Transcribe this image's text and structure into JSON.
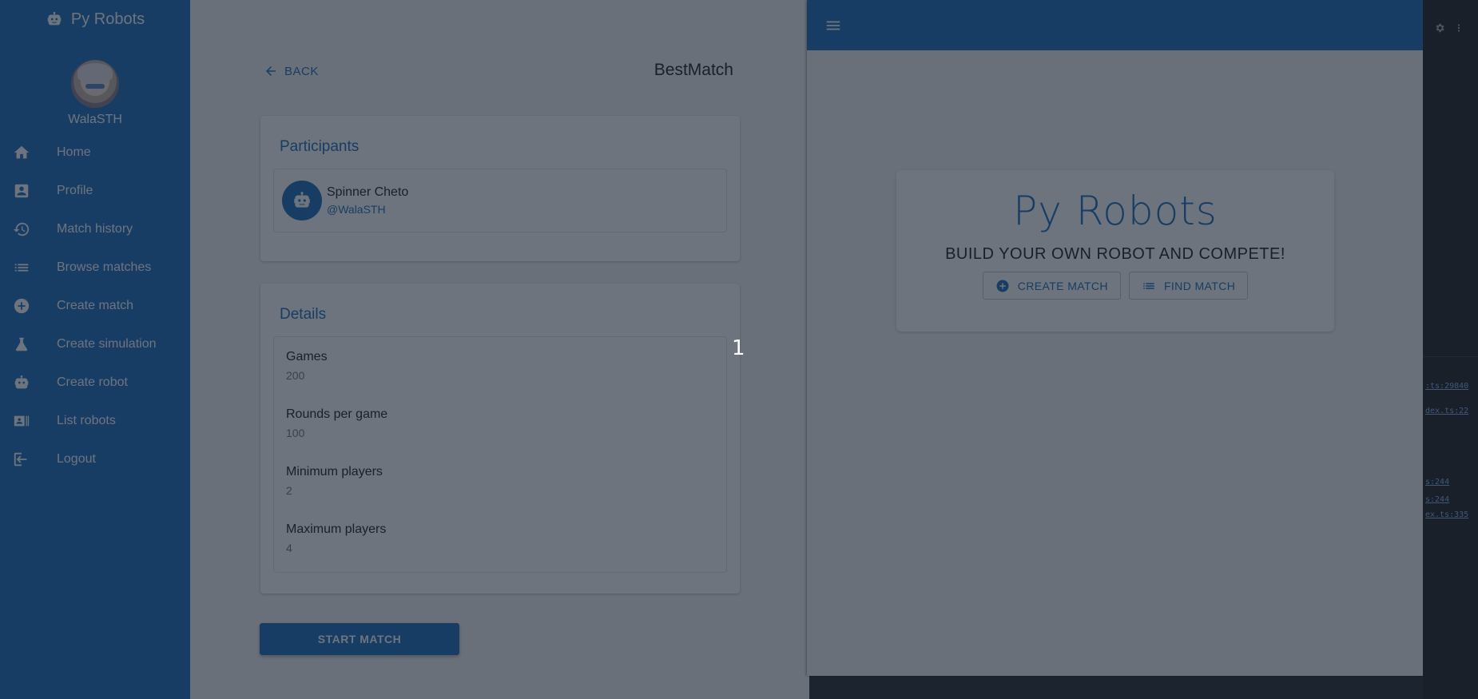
{
  "left_app": {
    "brand": "Py Robots",
    "user": {
      "name": "WalaSTH"
    },
    "nav": [
      {
        "label": "Home",
        "icon": "home-icon"
      },
      {
        "label": "Profile",
        "icon": "account-box-icon"
      },
      {
        "label": "Match history",
        "icon": "history-icon"
      },
      {
        "label": "Browse matches",
        "icon": "list-icon"
      },
      {
        "label": "Create match",
        "icon": "add-circle-icon"
      },
      {
        "label": "Create simulation",
        "icon": "flask-icon"
      },
      {
        "label": "Create robot",
        "icon": "robot-icon"
      },
      {
        "label": "List robots",
        "icon": "badge-list-icon"
      },
      {
        "label": "Logout",
        "icon": "logout-icon"
      }
    ],
    "back_label": "BACK",
    "match_name": "BestMatch",
    "participants": {
      "title": "Participants",
      "items": [
        {
          "name": "Spinner Cheto",
          "handle": "@WalaSTH"
        }
      ]
    },
    "details": {
      "title": "Details",
      "items": [
        {
          "label": "Games",
          "value": "200"
        },
        {
          "label": "Rounds per game",
          "value": "100"
        },
        {
          "label": "Minimum players",
          "value": "2"
        },
        {
          "label": "Maximum players",
          "value": "4"
        }
      ]
    },
    "start_label": "START MATCH"
  },
  "right_app": {
    "hero_title": "Py Robots",
    "tagline": "BUILD YOUR OWN ROBOT AND COMPETE!",
    "create_match_label": "CREATE MATCH",
    "find_match_label": "FIND MATCH"
  },
  "devtools": {
    "lines": [
      ":ts:29840",
      "dex.ts:22",
      "s:244",
      "s:244",
      "ex.ts:335"
    ]
  },
  "step_marker": "1",
  "colors": {
    "primary": "#1e6fc0",
    "overlay": "rgba(20,30,45,0.62)"
  }
}
